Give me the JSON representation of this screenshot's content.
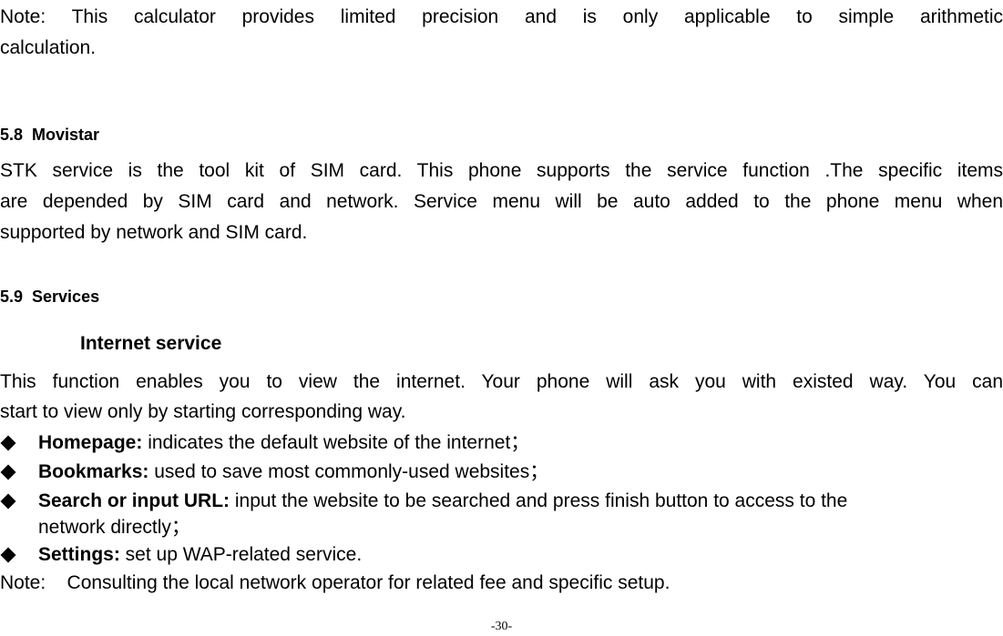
{
  "top_note": {
    "line1": "Note: This calculator provides limited precision and is only applicable to simple arithmetic",
    "line2": "calculation."
  },
  "section_5_8": {
    "heading": "5.8  Movistar",
    "paragraph_lines": [
      "STK service is the tool kit of SIM card. This phone supports the service function .The specific items",
      "are depended by SIM card and network. Service menu will be auto added to the phone menu when",
      "supported by network and SIM card."
    ]
  },
  "section_5_9": {
    "heading": "5.9  Services",
    "subheading": "Internet service",
    "paragraph_lines": [
      "This function enables you to view the internet. Your phone will ask you with existed way. You can",
      "start to view only by starting corresponding way."
    ],
    "bullets": [
      {
        "icon": "diamond-bullet-icon",
        "term": "Homepage:",
        "text": " indicates the default website of the internet；"
      },
      {
        "icon": "diamond-bullet-icon",
        "term": "Bookmarks:",
        "text": " used to save most commonly-used websites；"
      },
      {
        "icon": "diamond-bullet-icon",
        "term": "Search or input URL:",
        "text": " input the website to be searched and press finish button to access to the",
        "continuation": "network directly；"
      },
      {
        "icon": "diamond-bullet-icon",
        "term": "Settings:",
        "text": " set up WAP-related service."
      }
    ],
    "note": "Note:    Consulting the local network operator for related fee and specific setup."
  },
  "footer": {
    "page_number": "-30-"
  }
}
